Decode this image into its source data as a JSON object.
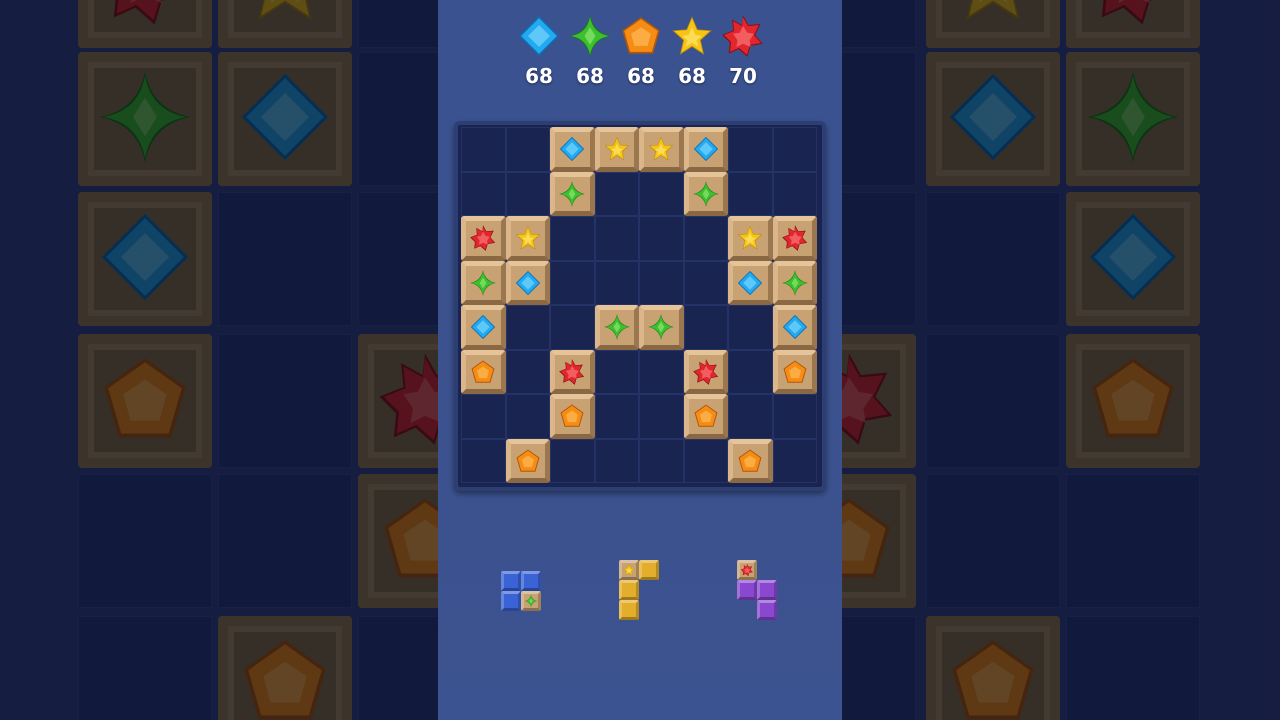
{
  "game": {
    "counters": [
      {
        "gem": "blue-diamond",
        "value": "68",
        "color": "#2ab0f0"
      },
      {
        "gem": "green-star",
        "value": "68",
        "color": "#3fbf32"
      },
      {
        "gem": "orange-pentagon",
        "value": "68",
        "color": "#f28e16"
      },
      {
        "gem": "yellow-star",
        "value": "68",
        "color": "#f5c516"
      },
      {
        "gem": "red-star",
        "value": "70",
        "color": "#e02a30"
      }
    ],
    "board": {
      "cols": 8,
      "rows": 8,
      "blocks": [
        {
          "row": 0,
          "col": 2,
          "gem": "blue"
        },
        {
          "row": 0,
          "col": 3,
          "gem": "yellow"
        },
        {
          "row": 0,
          "col": 4,
          "gem": "yellow"
        },
        {
          "row": 0,
          "col": 5,
          "gem": "blue"
        },
        {
          "row": 1,
          "col": 2,
          "gem": "green"
        },
        {
          "row": 1,
          "col": 5,
          "gem": "green"
        },
        {
          "row": 2,
          "col": 0,
          "gem": "red"
        },
        {
          "row": 2,
          "col": 1,
          "gem": "yellow"
        },
        {
          "row": 2,
          "col": 6,
          "gem": "yellow"
        },
        {
          "row": 2,
          "col": 7,
          "gem": "red"
        },
        {
          "row": 3,
          "col": 0,
          "gem": "green"
        },
        {
          "row": 3,
          "col": 1,
          "gem": "blue"
        },
        {
          "row": 3,
          "col": 6,
          "gem": "blue"
        },
        {
          "row": 3,
          "col": 7,
          "gem": "green"
        },
        {
          "row": 4,
          "col": 0,
          "gem": "blue"
        },
        {
          "row": 4,
          "col": 3,
          "gem": "green"
        },
        {
          "row": 4,
          "col": 4,
          "gem": "green"
        },
        {
          "row": 4,
          "col": 7,
          "gem": "blue"
        },
        {
          "row": 5,
          "col": 0,
          "gem": "orange"
        },
        {
          "row": 5,
          "col": 2,
          "gem": "red"
        },
        {
          "row": 5,
          "col": 5,
          "gem": "red"
        },
        {
          "row": 5,
          "col": 7,
          "gem": "orange"
        },
        {
          "row": 6,
          "col": 2,
          "gem": "orange"
        },
        {
          "row": 6,
          "col": 5,
          "gem": "orange"
        },
        {
          "row": 7,
          "col": 1,
          "gem": "orange"
        },
        {
          "row": 7,
          "col": 6,
          "gem": "orange"
        }
      ]
    },
    "pieces": [
      {
        "name": "blue-square-piece",
        "color": "blue",
        "cells": [
          {
            "r": 0,
            "c": 0
          },
          {
            "r": 0,
            "c": 1
          },
          {
            "r": 1,
            "c": 0
          },
          {
            "r": 1,
            "c": 1,
            "gem": "green"
          }
        ]
      },
      {
        "name": "yellow-l-piece",
        "color": "yellow",
        "cells": [
          {
            "r": 0,
            "c": 0,
            "gem": "yellow"
          },
          {
            "r": 0,
            "c": 1
          },
          {
            "r": 1,
            "c": 0
          },
          {
            "r": 2,
            "c": 0
          }
        ]
      },
      {
        "name": "purple-s-piece",
        "color": "purple",
        "cells": [
          {
            "r": 0,
            "c": 0,
            "gem": "red"
          },
          {
            "r": 1,
            "c": 0
          },
          {
            "r": 1,
            "c": 1
          },
          {
            "r": 2,
            "c": 1
          }
        ]
      }
    ],
    "colors": {
      "panel": "#3a5290",
      "board": "#1a2450",
      "wood": "#c9a273"
    }
  }
}
